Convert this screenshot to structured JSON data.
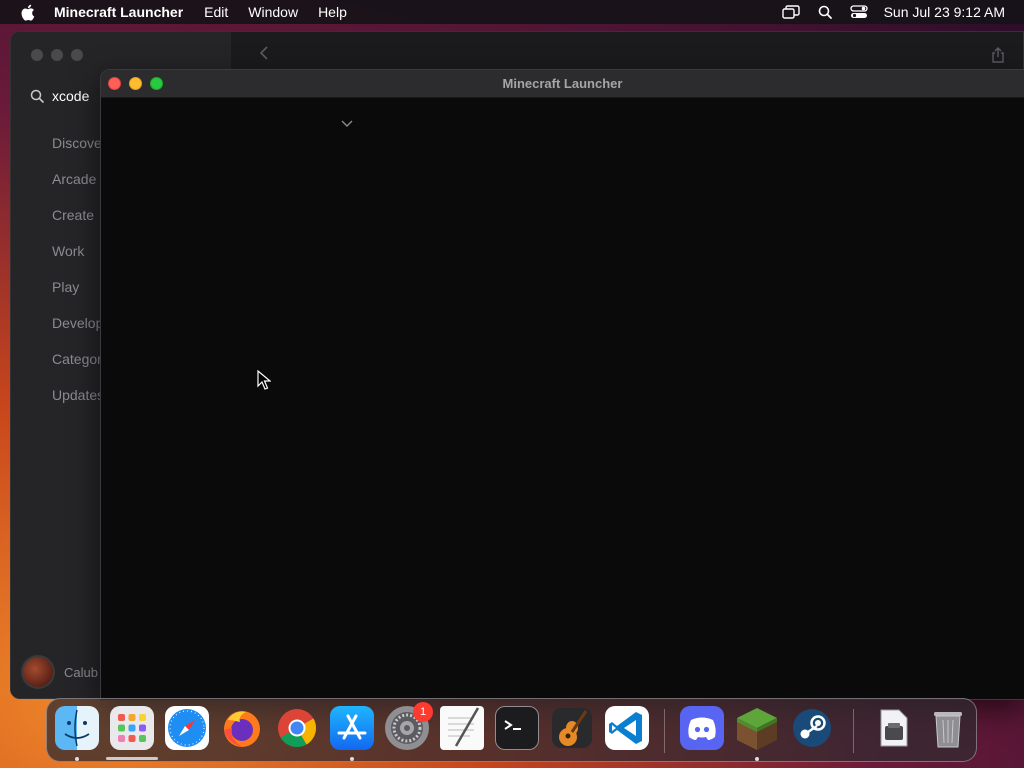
{
  "menubar": {
    "apple_icon": "apple-logo-icon",
    "app_name": "Minecraft Launcher",
    "items": [
      "Edit",
      "Window",
      "Help"
    ],
    "status_icons": [
      "screen-mirroring-icon",
      "spotlight-search-icon",
      "control-center-icon"
    ],
    "clock": "Sun Jul 23  9:12 AM"
  },
  "appstore": {
    "search_value": "xcode",
    "nav_items": [
      "Discover",
      "Arcade",
      "Create",
      "Work",
      "Play",
      "Develop",
      "Categories",
      "Updates"
    ],
    "user_name": "Calub"
  },
  "launcher": {
    "title": "Minecraft Launcher"
  },
  "dock": {
    "apps": [
      {
        "name": "Finder",
        "icon": "finder-icon"
      },
      {
        "name": "Launchpad",
        "icon": "launchpad-icon"
      },
      {
        "name": "Safari",
        "icon": "safari-icon"
      },
      {
        "name": "Firefox",
        "icon": "firefox-icon"
      },
      {
        "name": "Google Chrome",
        "icon": "chrome-icon"
      },
      {
        "name": "App Store",
        "icon": "app-store-icon"
      },
      {
        "name": "System Settings",
        "icon": "system-settings-icon",
        "badge": "1"
      },
      {
        "name": "TextEdit",
        "icon": "textedit-icon"
      },
      {
        "name": "Terminal",
        "icon": "terminal-icon"
      },
      {
        "name": "GarageBand",
        "icon": "garageband-icon"
      },
      {
        "name": "Visual Studio Code",
        "icon": "vscode-icon"
      },
      {
        "name": "Discord",
        "icon": "discord-icon"
      },
      {
        "name": "Minecraft",
        "icon": "minecraft-icon"
      },
      {
        "name": "Steam",
        "icon": "steam-icon"
      },
      {
        "name": "Preview",
        "icon": "preview-icon"
      },
      {
        "name": "Trash",
        "icon": "trash-icon"
      }
    ]
  }
}
